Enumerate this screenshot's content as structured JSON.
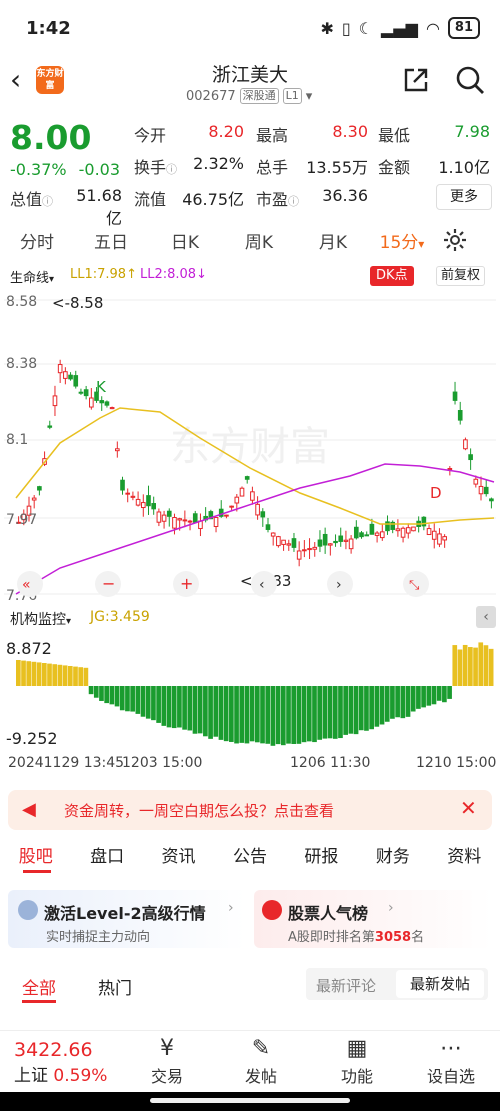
{
  "status": {
    "time": "1:42",
    "battery": "81"
  },
  "header": {
    "name": "浙江美大",
    "code": "002677",
    "market": "深股通",
    "level": "L1",
    "logo": "东方财富"
  },
  "quote": {
    "price": "8.00",
    "change_pct": "-0.37%",
    "change": "-0.03",
    "open_label": "今开",
    "open": "8.20",
    "high_label": "最高",
    "high": "8.30",
    "low_label": "最低",
    "low": "7.98",
    "turnover_label": "换手",
    "turnover": "2.32%",
    "volume_label": "总手",
    "volume": "13.55万",
    "amount_label": "金额",
    "amount": "1.10亿",
    "mcap_label": "总值",
    "mcap": "51.68亿",
    "float_label": "流值",
    "float_mcap": "46.75亿",
    "pe_label": "市盈",
    "pe": "36.36",
    "more_label": "更多"
  },
  "period_tabs": [
    "分时",
    "五日",
    "日K",
    "周K",
    "月K",
    "15分"
  ],
  "active_period": "15分",
  "indicator": {
    "name": "生命线",
    "ll1": "LL1:7.98",
    "ll1_arrow": "↑",
    "ll2": "LL2:8.08",
    "ll2_arrow": "↓",
    "dk": "DK点",
    "fq": "前复权"
  },
  "chart_labels": {
    "y_top": "8.58",
    "y_mid": "8.38",
    "y_mid2": "8.1",
    "y_low": "7.97",
    "y_bottom": "7.76",
    "max_mark": "<-8.58",
    "min_mark": "<-7.83",
    "k_mark": "K",
    "d_mark": "D",
    "watermark": "东方财富"
  },
  "jg": {
    "name": "机构监控",
    "value": "JG:3.459",
    "top": "8.872",
    "bottom": "-9.252"
  },
  "dates": [
    "20241129 13:45",
    "1203 15:00",
    "1206 11:30",
    "1210 15:00"
  ],
  "banner": {
    "text": "资金周转，一周空白期怎么投？点击查看"
  },
  "info_tabs": [
    "股吧",
    "盘口",
    "资讯",
    "公告",
    "研报",
    "财务",
    "资料"
  ],
  "active_info_tab": "股吧",
  "cards": [
    {
      "title": "激活Level-2高级行情",
      "sub": "实时捕捉主力动向"
    },
    {
      "title": "股票人气榜",
      "sub_prefix": "A股即时排名第",
      "rank": "3058",
      "sub_suffix": "名"
    }
  ],
  "feed_tabs": {
    "all": "全部",
    "hot": "热门",
    "latest_comment": "最新评论",
    "latest_post": "最新发帖"
  },
  "bottom_nav": {
    "index_value": "3422.66",
    "index_name": "上证",
    "index_pct": "0.59%",
    "items": [
      "交易",
      "发帖",
      "功能",
      "设自选"
    ]
  },
  "colors": {
    "up": "#e8272a",
    "down": "#1a9c2f",
    "accent": "#f26a1b",
    "ma1": "#e8c020",
    "ma2": "#c21fd6"
  }
}
